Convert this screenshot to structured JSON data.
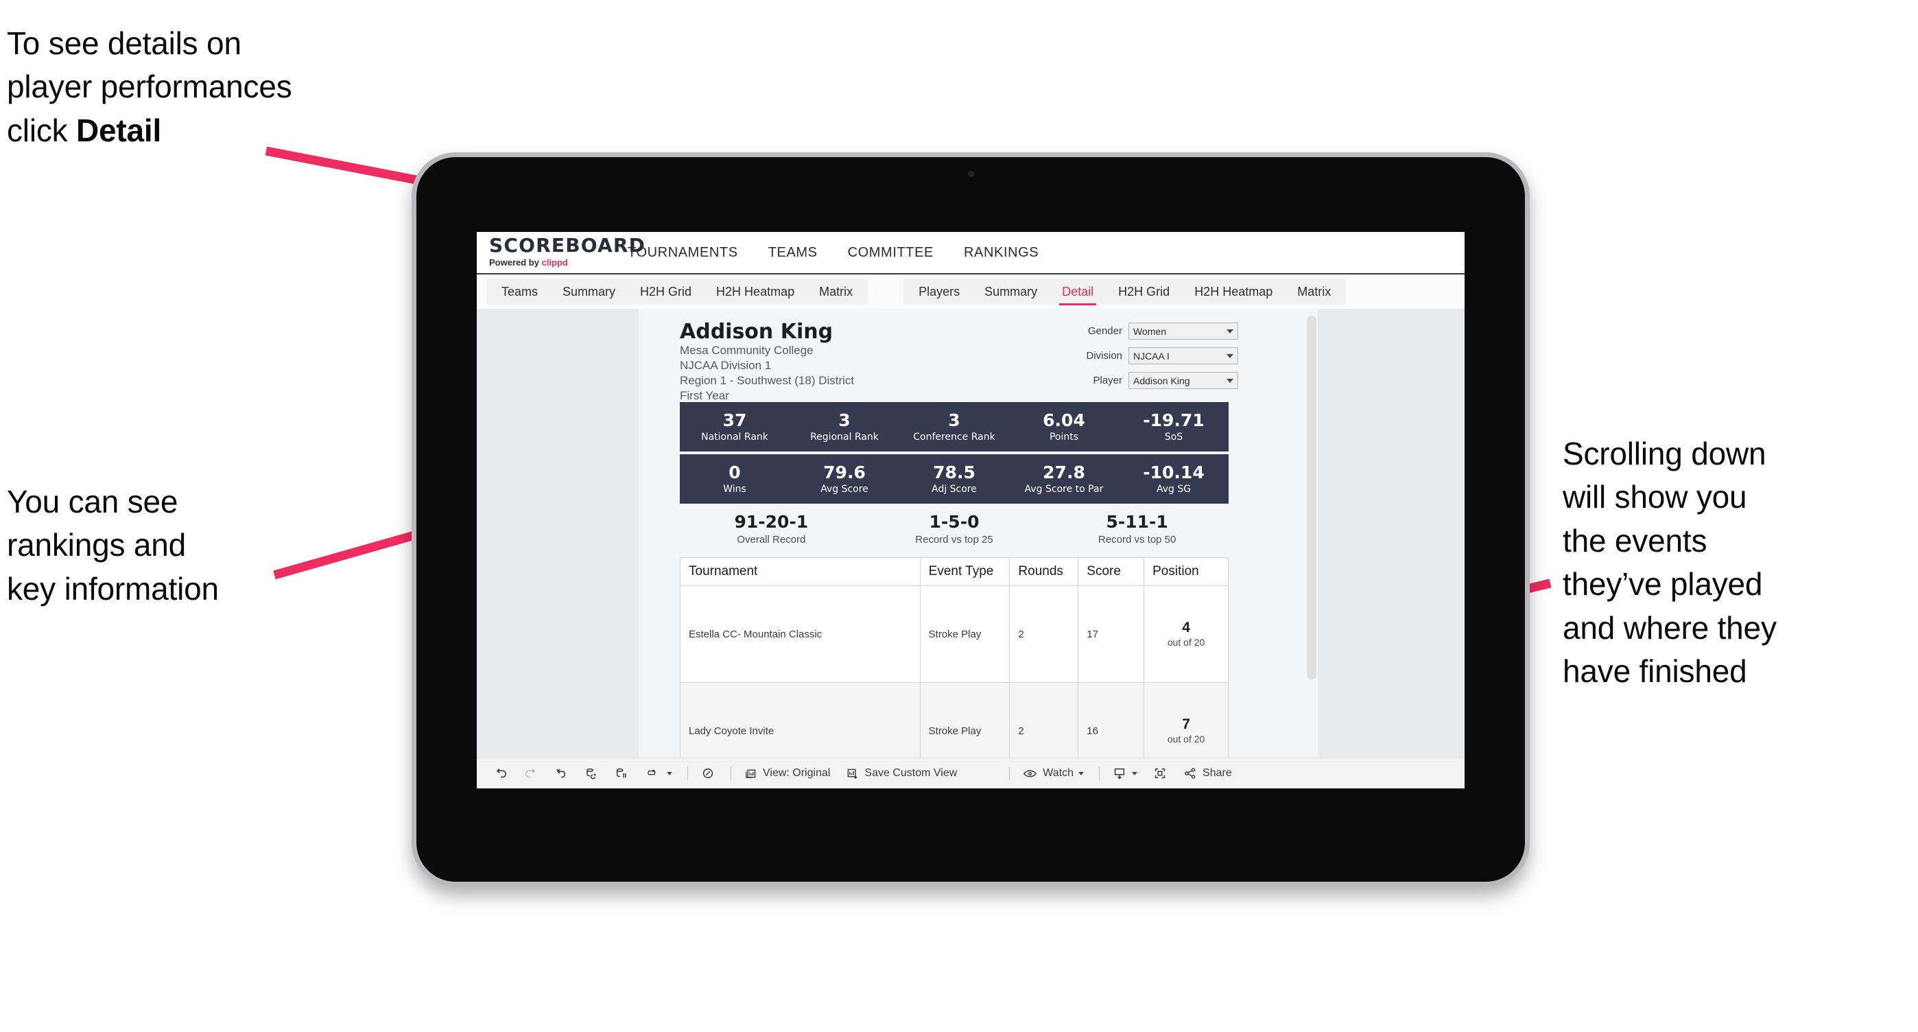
{
  "annotations": {
    "top_left": {
      "line1": "To see details on",
      "line2": "player performances",
      "line3_pre": "click ",
      "line3_bold": "Detail"
    },
    "mid_left": {
      "line1": "You can see",
      "line2": "rankings and",
      "line3": "key information"
    },
    "right": {
      "line1": "Scrolling down",
      "line2": "will show you",
      "line3": "the events",
      "line4": "they’ve played",
      "line5": "and where they",
      "line6": "have finished"
    },
    "arrow_color": "#ee2c5f"
  },
  "app": {
    "brand": {
      "wordmark": "SCOREBOARD",
      "powered_prefix": "Powered by ",
      "powered_name": "clippd"
    },
    "top_nav": [
      "TOURNAMENTS",
      "TEAMS",
      "COMMITTEE",
      "RANKINGS"
    ],
    "tab_groups": [
      {
        "name": "teams-tabs",
        "tabs": [
          {
            "label": "Teams",
            "active": false
          },
          {
            "label": "Summary",
            "active": false
          },
          {
            "label": "H2H Grid",
            "active": false
          },
          {
            "label": "H2H Heatmap",
            "active": false
          },
          {
            "label": "Matrix",
            "active": false
          }
        ]
      },
      {
        "name": "players-tabs",
        "tabs": [
          {
            "label": "Players",
            "active": false
          },
          {
            "label": "Summary",
            "active": false
          },
          {
            "label": "Detail",
            "active": true
          },
          {
            "label": "H2H Grid",
            "active": false
          },
          {
            "label": "H2H Heatmap",
            "active": false
          },
          {
            "label": "Matrix",
            "active": false
          }
        ]
      }
    ],
    "accent_color": "#ee2b59",
    "statbar_color": "#343a4f"
  },
  "player": {
    "name": "Addison King",
    "school": "Mesa Community College",
    "division": "NJCAA Division 1",
    "region": "Region 1 - Southwest (18) District",
    "class_year": "First Year"
  },
  "filters": [
    {
      "label": "Gender",
      "value": "Women"
    },
    {
      "label": "Division",
      "value": "NJCAA I"
    },
    {
      "label": "Player",
      "value": "Addison King"
    }
  ],
  "stat_rows": [
    [
      {
        "value": "37",
        "label": "National Rank"
      },
      {
        "value": "3",
        "label": "Regional Rank"
      },
      {
        "value": "3",
        "label": "Conference Rank"
      },
      {
        "value": "6.04",
        "label": "Points"
      },
      {
        "value": "-19.71",
        "label": "SoS"
      }
    ],
    [
      {
        "value": "0",
        "label": "Wins"
      },
      {
        "value": "79.6",
        "label": "Avg Score"
      },
      {
        "value": "78.5",
        "label": "Adj Score"
      },
      {
        "value": "27.8",
        "label": "Avg Score to Par"
      },
      {
        "value": "-10.14",
        "label": "Avg SG"
      }
    ]
  ],
  "records": [
    {
      "value": "91-20-1",
      "label": "Overall Record"
    },
    {
      "value": "1-5-0",
      "label": "Record vs top 25"
    },
    {
      "value": "5-11-1",
      "label": "Record vs top 50"
    }
  ],
  "events_table": {
    "columns": [
      "Tournament",
      "Event Type",
      "Rounds",
      "Score",
      "Position"
    ],
    "rows": [
      {
        "tournament": "Estella CC- Mountain Classic",
        "event_type": "Stroke Play",
        "rounds": "2",
        "score": "17",
        "position_value": "4",
        "position_of": "out of 20"
      },
      {
        "tournament": "Lady Coyote Invite",
        "event_type": "Stroke Play",
        "rounds": "2",
        "score": "16",
        "position_value": "7",
        "position_of": "out of 20"
      }
    ]
  },
  "toolbar": {
    "view_label": "View: Original",
    "save_label": "Save Custom View",
    "watch_label": "Watch",
    "share_label": "Share"
  }
}
